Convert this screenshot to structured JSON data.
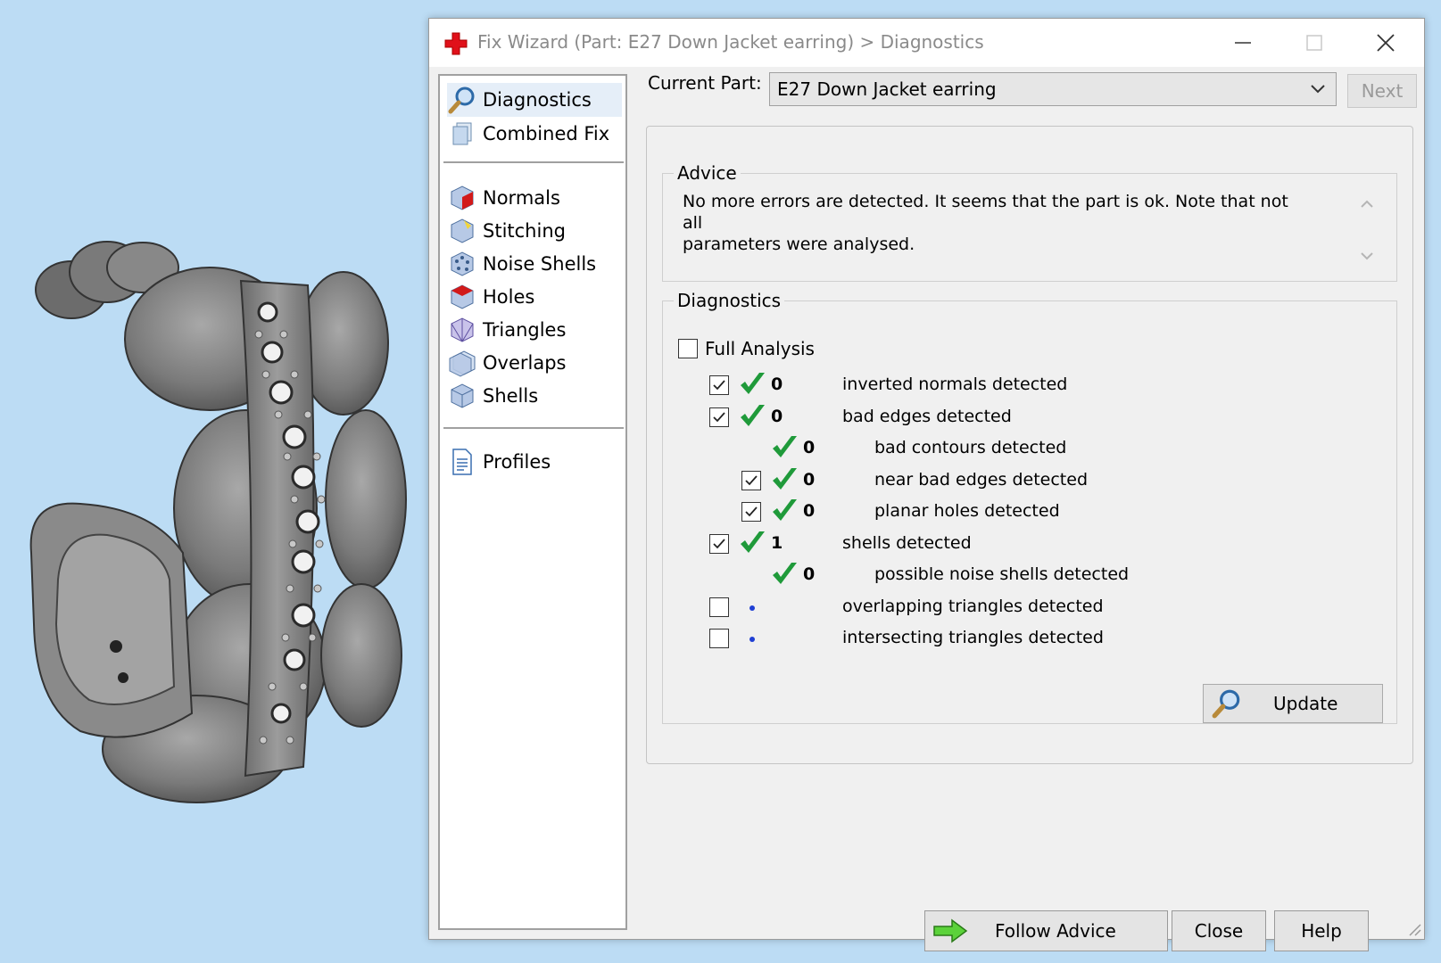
{
  "window": {
    "title": "Fix Wizard (Part: E27 Down Jacket earring) > Diagnostics"
  },
  "sidebar": {
    "groups": [
      [
        {
          "label": "Diagnostics",
          "icon": "magnifier-icon",
          "selected": true
        },
        {
          "label": "Combined Fix",
          "icon": "combined-fix-icon"
        }
      ],
      [
        {
          "label": "Normals",
          "icon": "normals-cube-icon"
        },
        {
          "label": "Stitching",
          "icon": "stitching-cube-icon"
        },
        {
          "label": "Noise Shells",
          "icon": "noise-shells-cube-icon"
        },
        {
          "label": "Holes",
          "icon": "holes-cube-icon"
        },
        {
          "label": "Triangles",
          "icon": "triangles-cube-icon"
        },
        {
          "label": "Overlaps",
          "icon": "overlaps-cube-icon"
        },
        {
          "label": "Shells",
          "icon": "shells-cube-icon"
        }
      ],
      [
        {
          "label": "Profiles",
          "icon": "document-icon"
        }
      ]
    ]
  },
  "part": {
    "label": "Current Part:",
    "value": "E27 Down Jacket earring",
    "next_label": "Next"
  },
  "advice": {
    "legend": "Advice",
    "text": "No more errors are detected. It seems that the part is ok. Note that not all\nparameters were analysed."
  },
  "diagnostics": {
    "legend": "Diagnostics",
    "full_analysis_label": "Full Analysis",
    "full_analysis_checked": false,
    "rows": [
      {
        "label": "inverted normals detected",
        "count": "0",
        "checkbox": true,
        "checked": true,
        "status": "ok",
        "indent": 0
      },
      {
        "label": "bad edges detected",
        "count": "0",
        "checkbox": true,
        "checked": true,
        "status": "ok",
        "indent": 0
      },
      {
        "label": "bad contours detected",
        "count": "0",
        "checkbox": false,
        "checked": false,
        "status": "ok",
        "indent": 1
      },
      {
        "label": "near bad edges detected",
        "count": "0",
        "checkbox": true,
        "checked": true,
        "status": "ok",
        "indent": 1
      },
      {
        "label": "planar holes detected",
        "count": "0",
        "checkbox": true,
        "checked": true,
        "status": "ok",
        "indent": 1
      },
      {
        "label": "shells detected",
        "count": "1",
        "checkbox": true,
        "checked": true,
        "status": "ok",
        "indent": 0
      },
      {
        "label": "possible noise shells detected",
        "count": "0",
        "checkbox": false,
        "checked": false,
        "status": "ok",
        "indent": 1
      },
      {
        "label": "overlapping triangles detected",
        "count": "",
        "checkbox": true,
        "checked": false,
        "status": "pending",
        "indent": 0
      },
      {
        "label": "intersecting triangles detected",
        "count": "",
        "checkbox": true,
        "checked": false,
        "status": "pending",
        "indent": 0
      }
    ],
    "update_label": "Update"
  },
  "footer": {
    "follow_advice_label": "Follow Advice",
    "close_label": "Close",
    "help_label": "Help"
  },
  "colors": {
    "background": "#bcdcf4",
    "check_green": "#1f9a3a",
    "pending_dot": "#1f3fd4",
    "model_gray": "#7c7c7c"
  }
}
